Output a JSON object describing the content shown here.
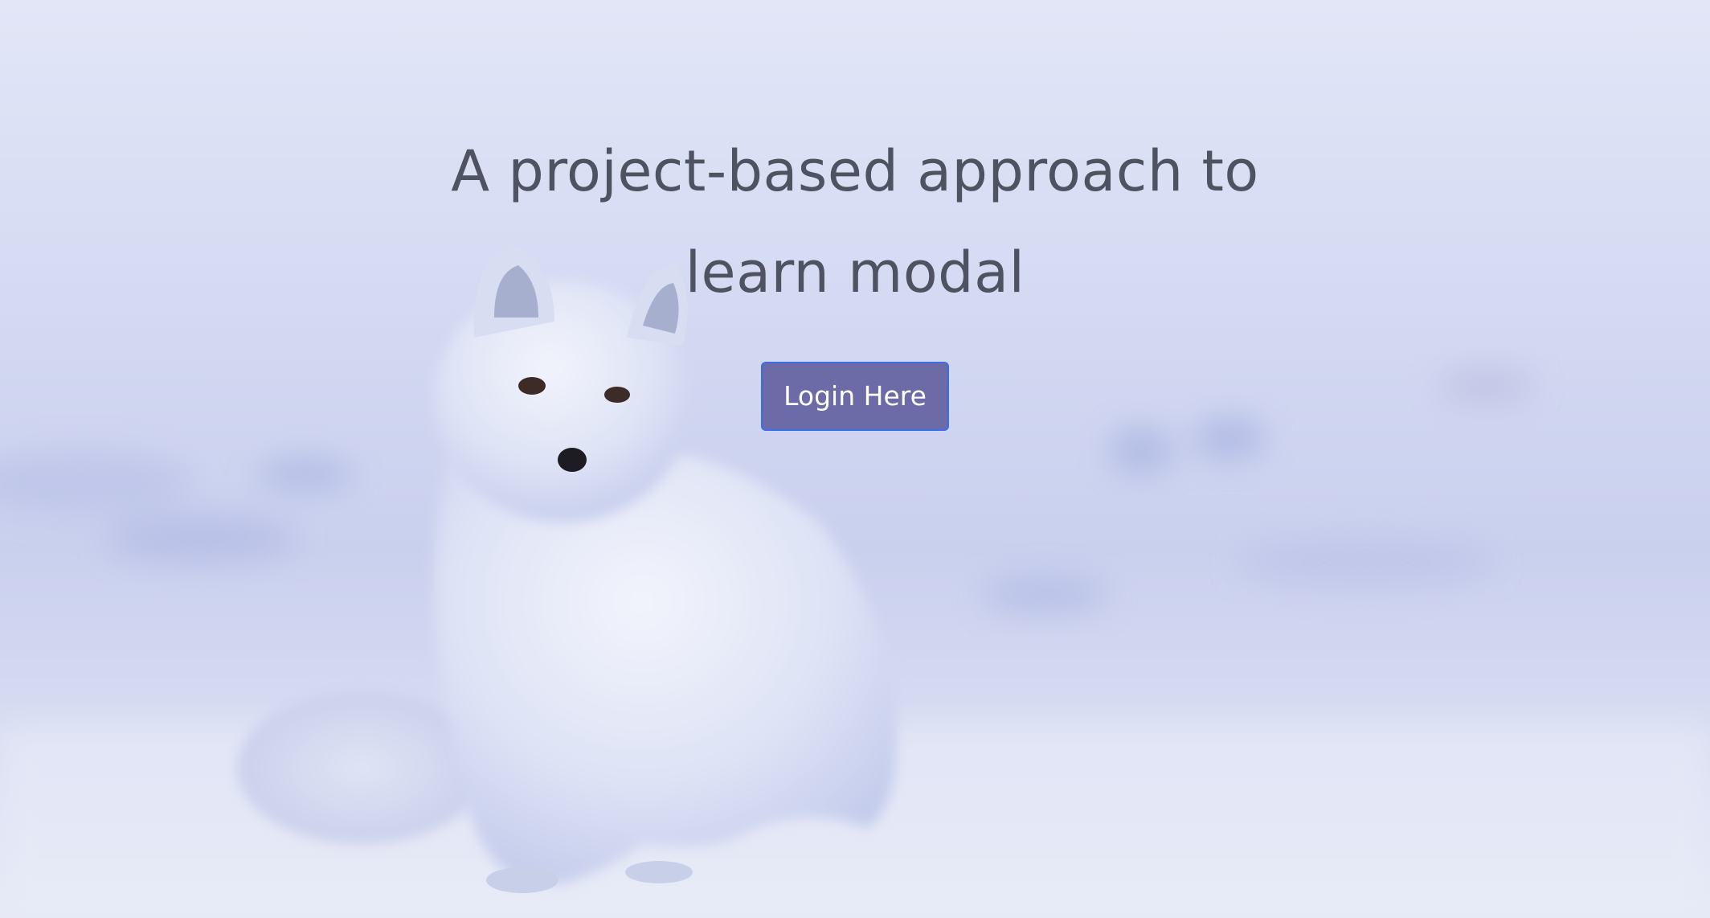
{
  "hero": {
    "title": "A project-based approach to learn modal",
    "login_label": "Login Here"
  },
  "colors": {
    "title_text": "#4f5260",
    "button_bg": "#6d6aa8",
    "button_border": "#3a6ee8",
    "snow_tint": "#dfe3f5"
  }
}
